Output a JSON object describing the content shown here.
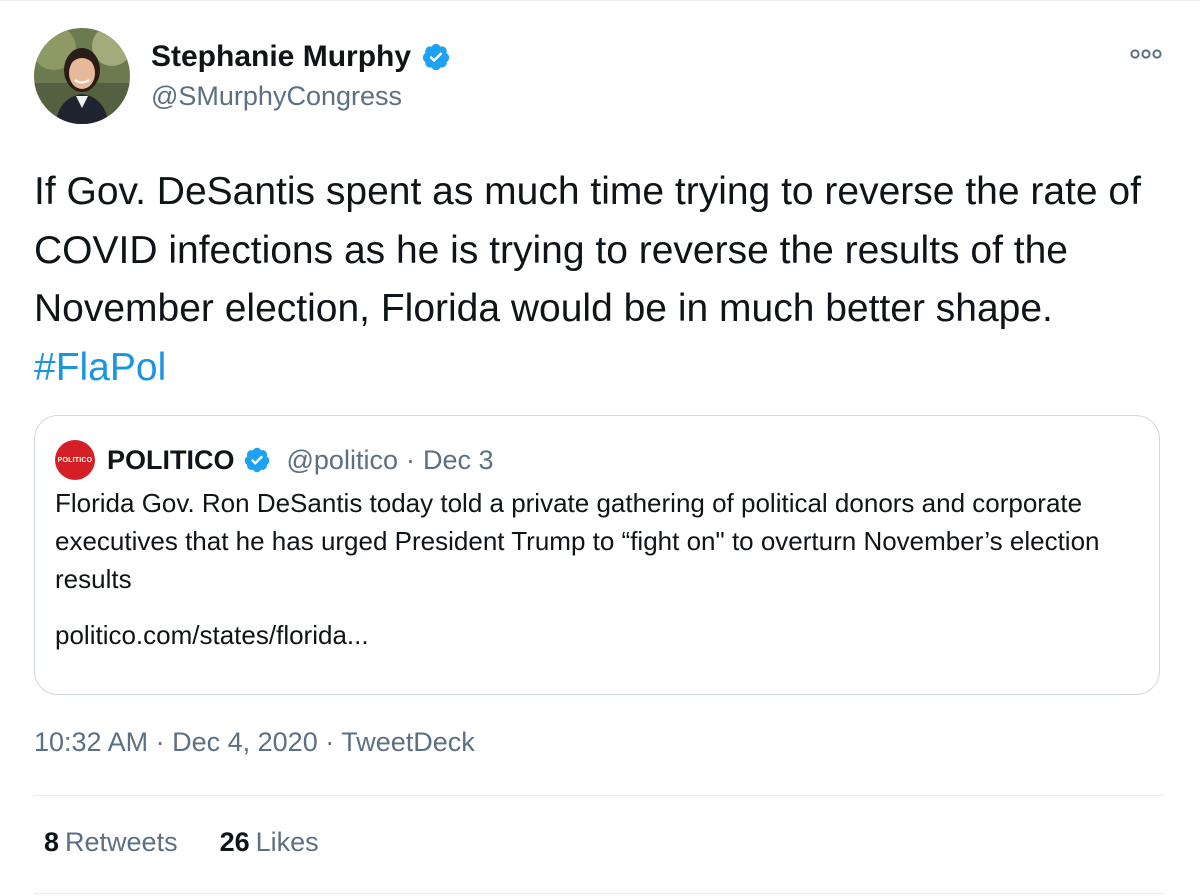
{
  "author": {
    "display_name": "Stephanie Murphy",
    "handle": "@SMurphyCongress",
    "verified": true
  },
  "tweet": {
    "text": "If Gov. DeSantis spent as much time trying to reverse the rate of COVID infections as he is trying to reverse the results of the November election, Florida would be in much better shape.",
    "hashtag": "#FlaPol"
  },
  "quoted_tweet": {
    "logo_text": "POLITICO",
    "display_name": "POLITICO",
    "handle": "@politico",
    "separator": "·",
    "date": "Dec 3",
    "text": "Florida Gov. Ron DeSantis today told a private gathering of political donors and corporate executives that he has urged President Trump to “fight on\" to overturn November’s election results",
    "link": "politico.com/states/florida..."
  },
  "meta": {
    "time": "10:32 AM",
    "separator": "·",
    "date": "Dec 4, 2020",
    "source": "TweetDeck"
  },
  "stats": {
    "retweets_count": "8",
    "retweets_label": "Retweets",
    "likes_count": "26",
    "likes_label": "Likes"
  },
  "colors": {
    "link_blue": "#1b95e0",
    "verified_blue": "#1da1f2",
    "politico_red": "#d41f26",
    "secondary_text": "#5b7083"
  },
  "icons": {
    "verified": "verified-badge-icon",
    "more": "more-options-icon"
  }
}
